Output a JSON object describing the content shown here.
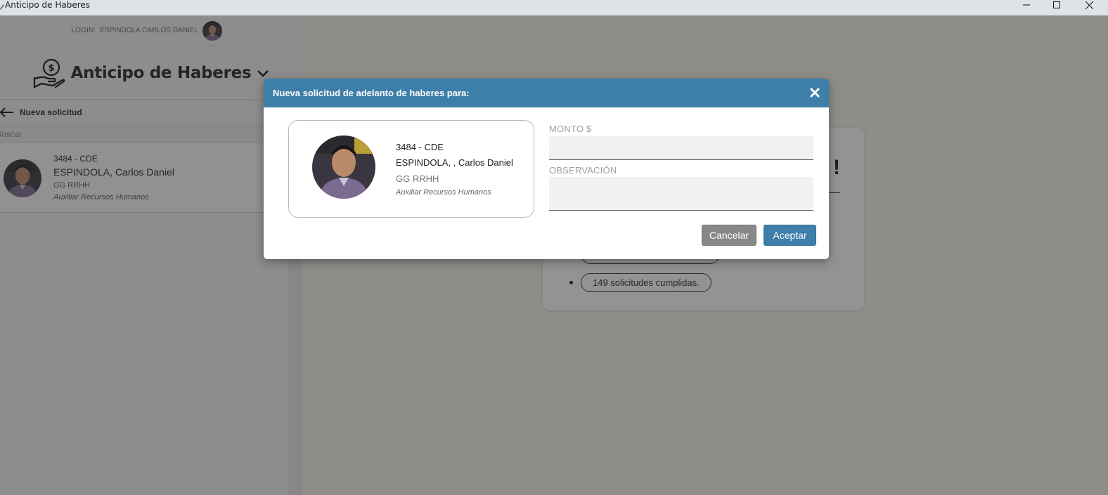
{
  "window": {
    "title": "Anticipo de Haberes",
    "controls": [
      "minimize-icon",
      "maximize-icon",
      "close-icon"
    ]
  },
  "sidebar": {
    "login_label": "LOGIN:",
    "login_name": "ESPINDOLA CARLOS DANIEL",
    "module_title": "Anticipo de Haberes",
    "module_icon": "hand-money-icon",
    "new_request_label": "Nueva solicitud",
    "search_placeholder": "Buscar",
    "employees": [
      {
        "code": "3484 - CDE",
        "name": "ESPINDOLA, Carlos Daniel",
        "dept": "GG RRHH",
        "role": "Auxiliar Recursos Humanos"
      }
    ]
  },
  "main": {
    "headline_fragment": "!",
    "stats": [
      {
        "text": ""
      },
      {
        "text": "149 solicitudes cumplidas."
      }
    ]
  },
  "modal": {
    "title": "Nueva solicitud de adelanto de haberes para:",
    "employee": {
      "code": "3484 - CDE",
      "name": "ESPINDOLA, , Carlos Daniel",
      "dept": "GG RRHH",
      "role": "Auxiliar Recursos Humanos"
    },
    "monto_label": "MONTO $",
    "monto_value": "",
    "observacion_label": "OBSERVACIÓN",
    "observacion_value": "",
    "cancel_label": "Cancelar",
    "accept_label": "Aceptar"
  },
  "colors": {
    "accent": "#3d7fa8",
    "cancel": "#888888",
    "overlay": "rgba(40,40,40,0.5)"
  }
}
